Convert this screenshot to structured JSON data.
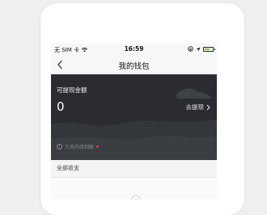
{
  "status_bar": {
    "carrier": "无 SIM 卡",
    "time": "16:59",
    "battery_level": 0.7,
    "icons": [
      "wifi-icon",
      "lock-rotation-icon",
      "location-arrow-icon",
      "battery-icon"
    ]
  },
  "navbar": {
    "back_icon": "chevron-left-icon",
    "title": "我的钱包"
  },
  "wallet": {
    "balance_label": "可提现金额",
    "balance": "0",
    "withdraw_label": "去提现",
    "note": "三天内待到账"
  },
  "transactions": {
    "section_label": "全部收支"
  },
  "colors": {
    "card_bg": "#2a2c30",
    "note_dot": "#e04040",
    "battery": "#4cd964"
  }
}
